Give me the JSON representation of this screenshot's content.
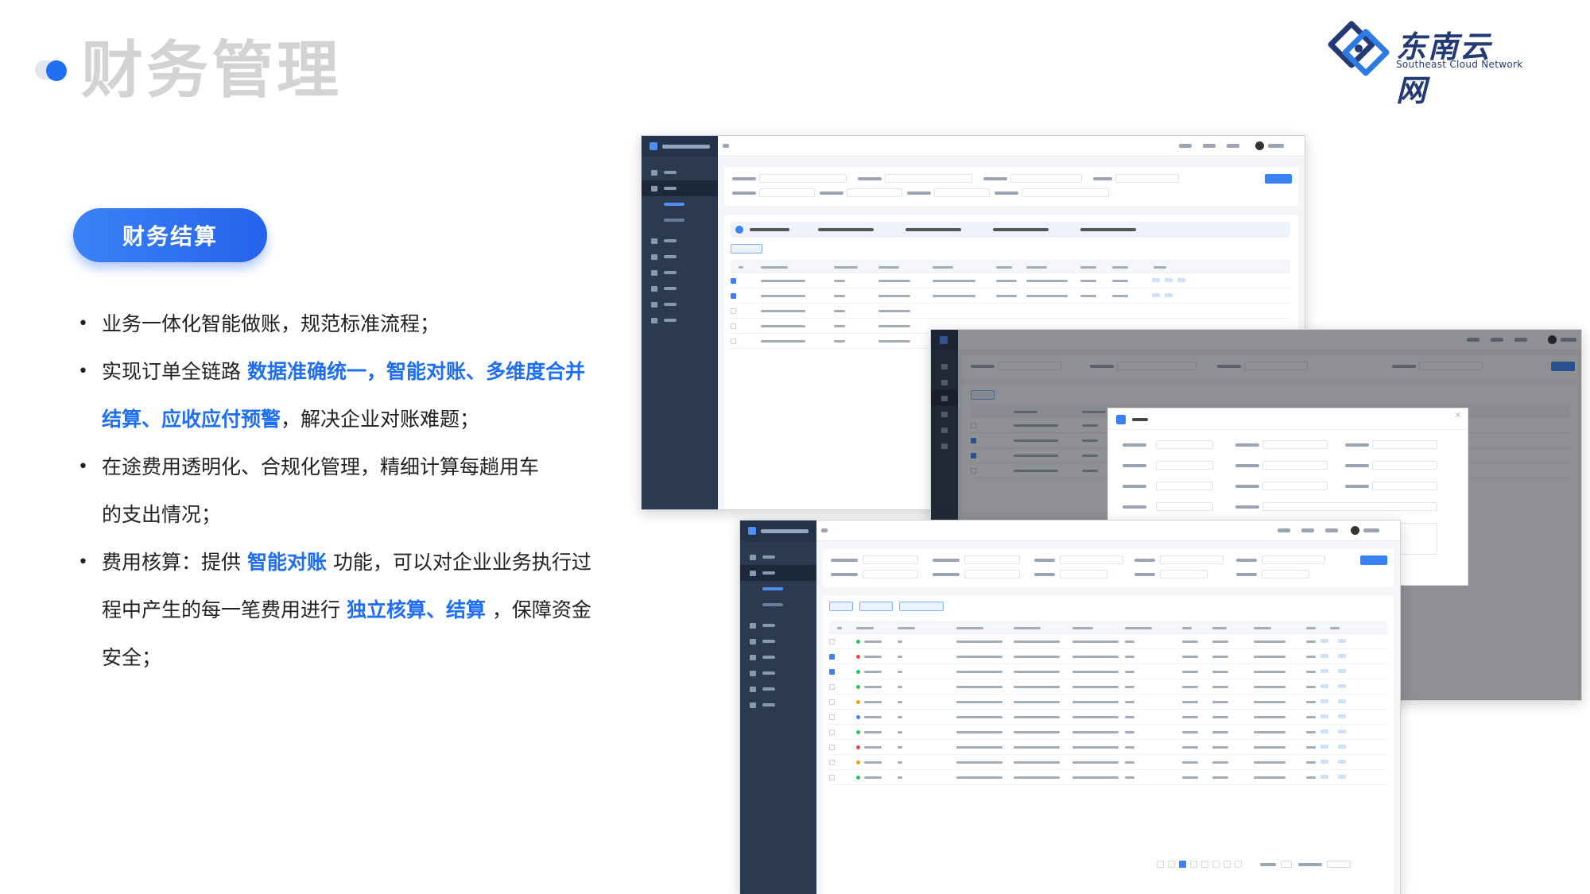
{
  "page": {
    "title": "财务管理"
  },
  "logo": {
    "name_cn": "东南云网",
    "name_en": "Southeast Cloud Network"
  },
  "section": {
    "pill_label": "财务结算"
  },
  "bullets": {
    "b1": "业务一体化智能做账，规范标准流程；",
    "b2_pre": "实现订单全链路 ",
    "b2_hl": "数据准确统一，智能对账、多维度合并结算、应收应付预警",
    "b2_post": "，解决企业对账难题；",
    "b3": "在途费用透明化、合规化管理，精细计算每趟用车的支出情况；",
    "b4_pre": "费用核算：提供 ",
    "b4_hl1": "智能对账",
    "b4_mid": " 功能，可以对企业业务执行过程中产生的每一笔费用进行 ",
    "b4_hl2": "独立核算、结算",
    "b4_post": " ，保障资金安全；"
  },
  "colors": {
    "accent": "#1f6ff2",
    "sidebar": "#2c3a4f",
    "title_gray": "#d3d3d6"
  },
  "icons": {
    "logo_mark": "diamond-network-icon",
    "bullet": "bullet-dot-icon"
  }
}
